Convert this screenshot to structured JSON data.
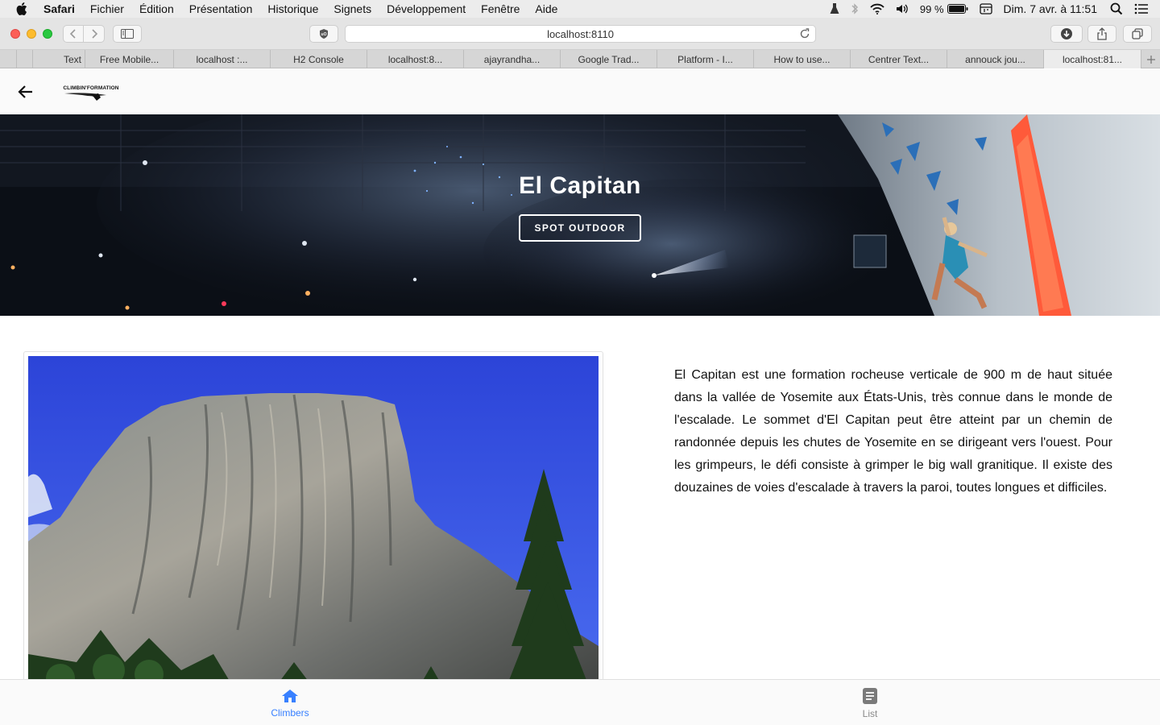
{
  "menubar": {
    "app_name": "Safari",
    "items": [
      "Fichier",
      "Édition",
      "Présentation",
      "Historique",
      "Signets",
      "Développement",
      "Fenêtre",
      "Aide"
    ],
    "battery": "99 %",
    "clock": "Dim. 7 avr. à  11:51"
  },
  "browser": {
    "url": "localhost:8110",
    "tabs": [
      "Text",
      "Free Mobile...",
      "localhost :...",
      "H2 Console",
      "localhost:8...",
      "ajayrandha...",
      "Google Trad...",
      "Platform - I...",
      "How to use...",
      "Centrer Text...",
      "annouck jou...",
      "localhost:81..."
    ],
    "active_tab_index": 11
  },
  "app": {
    "logo_text": "CLIMBIN'FORMATION"
  },
  "hero": {
    "title": "El Capitan",
    "button": "SPOT OUTDOOR"
  },
  "content": {
    "description": "El Capitan est une formation rocheuse verticale de 900 m de haut située dans la vallée de Yosemite aux États-Unis, très connue dans le monde de l'escalade. Le sommet d'El Capitan peut être atteint par un chemin de randonnée depuis les chutes de Yosemite en se dirigeant vers l'ouest. Pour les grimpeurs, le défi consiste à grimper le big wall granitique. Il existe des douzaines de voies d'escalade à travers la paroi, toutes longues et difficiles."
  },
  "bottom_nav": {
    "items": [
      {
        "label": "Climbers",
        "icon": "home-icon",
        "active": true
      },
      {
        "label": "List",
        "icon": "document-icon",
        "active": false
      }
    ]
  },
  "colors": {
    "accent": "#3880ff",
    "sky": "#2f4fe0",
    "hero_dark": "#0b0f16"
  }
}
